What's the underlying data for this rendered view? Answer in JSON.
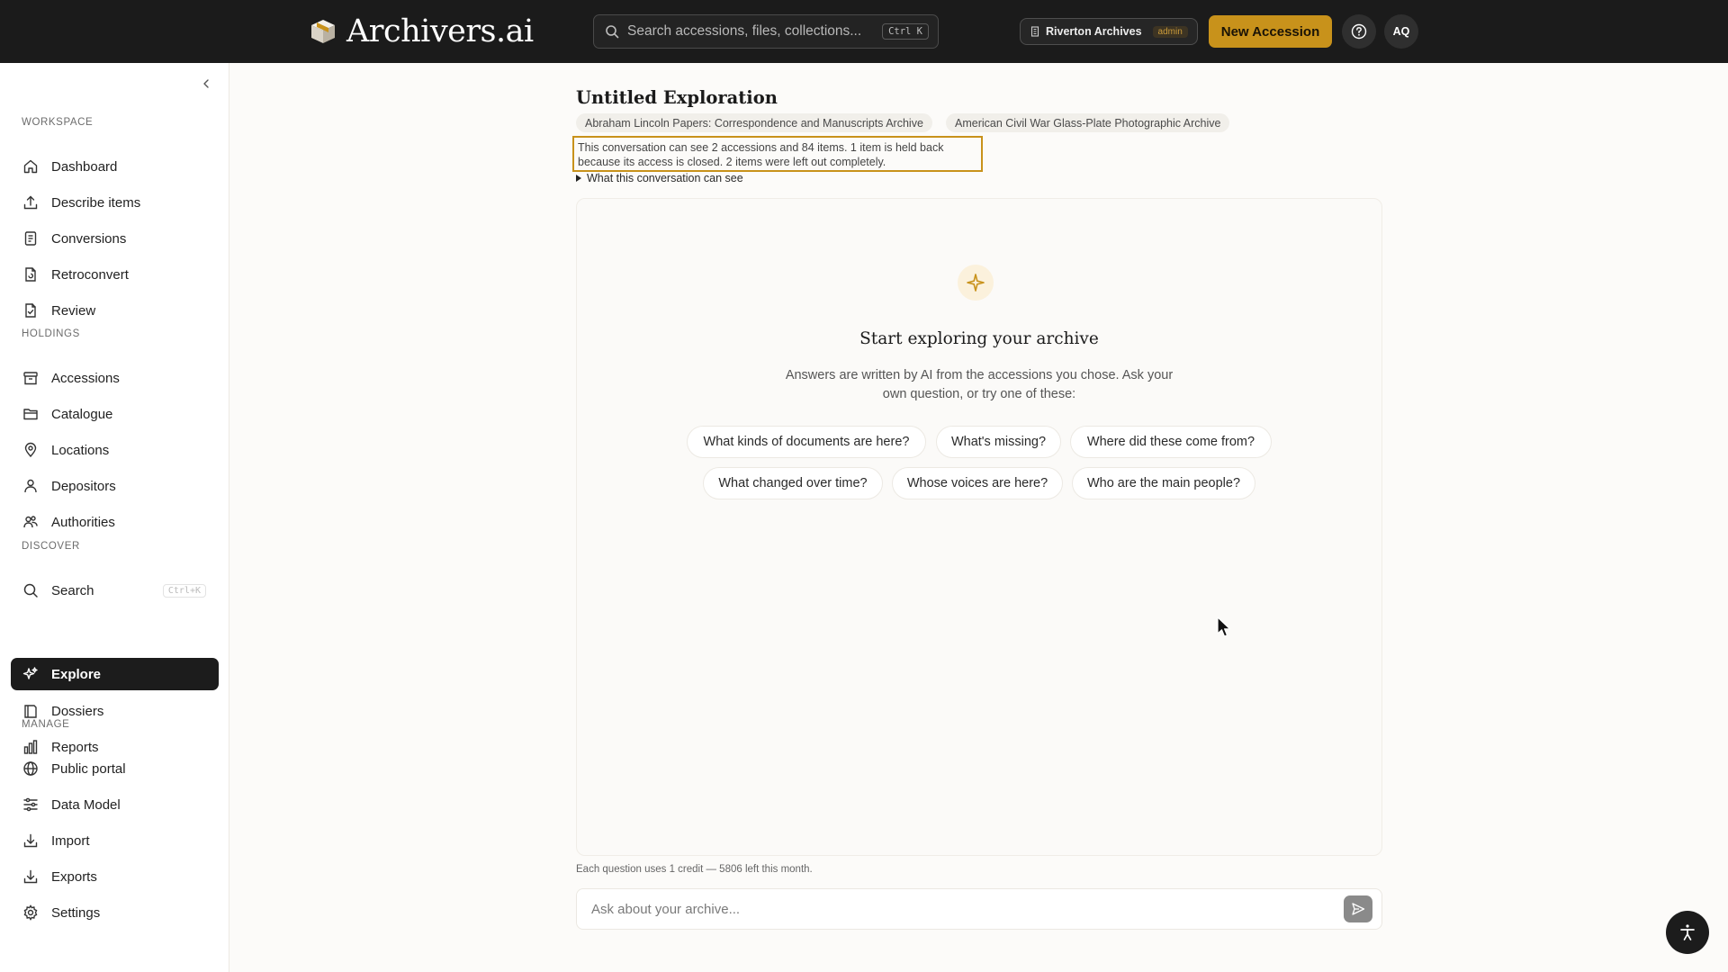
{
  "header": {
    "brand": "Archivers.ai",
    "search_placeholder": "Search accessions, files, collections...",
    "search_shortcut": "Ctrl K",
    "workspace_name": "Riverton Archives",
    "workspace_role": "admin",
    "new_accession_label": "New Accession",
    "avatar_initials": "AQ"
  },
  "sidebar": {
    "sections": [
      {
        "label": "WORKSPACE",
        "items": [
          "Dashboard",
          "Describe items",
          "Conversions",
          "Retroconvert",
          "Review"
        ]
      },
      {
        "label": "HOLDINGS",
        "items": [
          "Accessions",
          "Catalogue",
          "Locations",
          "Depositors",
          "Authorities"
        ]
      },
      {
        "label": "DISCOVER",
        "items": [
          "Search",
          "Explore",
          "Dossiers",
          "Reports"
        ]
      },
      {
        "label": "MANAGE",
        "items": [
          "Public portal",
          "Data Model",
          "Import",
          "Exports",
          "Settings"
        ]
      }
    ],
    "search_shortcut": "Ctrl+K",
    "active_item": "Explore"
  },
  "main": {
    "title": "Untitled Exploration",
    "chips": [
      "Abraham Lincoln Papers: Correspondence and Manuscripts Archive",
      "American Civil War Glass-Plate Photographic Archive"
    ],
    "notice_line1": "This conversation can see 2 accessions and 84 items. 1 item is held back",
    "notice_line2": "because its access is closed. 2 items were left out completely.",
    "disclosure_label": "What this conversation can see",
    "empty_title": "Start exploring your archive",
    "empty_sub_line1": "Answers are written by AI from the accessions you chose. Ask your",
    "empty_sub_line2": "own question, or try one of these:",
    "suggestions": [
      "What kinds of documents are here?",
      "What's missing?",
      "Where did these come from?",
      "What changed over time?",
      "Whose voices are here?",
      "Who are the main people?"
    ],
    "credits": "Each question uses 1 credit — 5806 left this month.",
    "composer_placeholder": "Ask about your archive..."
  },
  "colors": {
    "accent": "#c8921b",
    "topbar": "#1b1b1b",
    "active_nav": "#1c1c1c"
  }
}
